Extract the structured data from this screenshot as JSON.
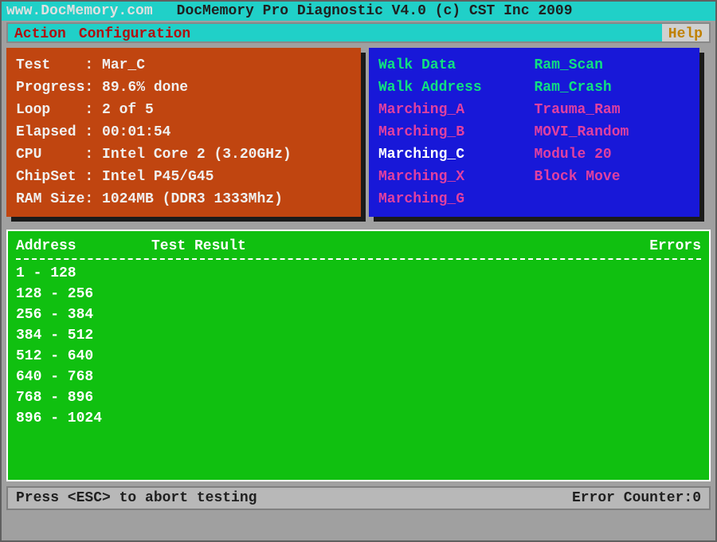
{
  "header": {
    "url": "www.DocMemory.com",
    "product": "DocMemory Pro Diagnostic V4.0  (c) CST Inc 2009"
  },
  "menu": {
    "action": "Action",
    "configuration": "Configuration",
    "help": "Help"
  },
  "status": {
    "test_label": "Test    : ",
    "test_value": "Mar_C",
    "progress_label": "Progress: ",
    "progress_value": "89.6% done",
    "loop_label": "Loop    : ",
    "loop_value": "2 of 5",
    "elapsed_label": "Elapsed : ",
    "elapsed_value": "00:01:54",
    "cpu_label": "CPU     : ",
    "cpu_value": "Intel Core 2 (3.20GHz)",
    "chipset_label": "ChipSet : ",
    "chipset_value": "Intel P45/G45",
    "ram_label": "RAM Size: ",
    "ram_value": "1024MB (DDR3 1333Mhz)"
  },
  "tests": {
    "col1": [
      {
        "name": "Walk Data",
        "color": "c-green"
      },
      {
        "name": "Walk Address",
        "color": "c-green"
      },
      {
        "name": "Marching_A",
        "color": "c-pink"
      },
      {
        "name": "Marching_B",
        "color": "c-pink"
      },
      {
        "name": "Marching_C",
        "color": "c-white"
      },
      {
        "name": "Marching_X",
        "color": "c-pink"
      },
      {
        "name": "Marching_G",
        "color": "c-pink"
      }
    ],
    "col2": [
      {
        "name": "Ram_Scan",
        "color": "c-green"
      },
      {
        "name": "Ram_Crash",
        "color": "c-green"
      },
      {
        "name": "Trauma_Ram",
        "color": "c-pink"
      },
      {
        "name": "MOVI_Random",
        "color": "c-pink"
      },
      {
        "name": "Module 20",
        "color": "c-pink"
      },
      {
        "name": "Block Move",
        "color": "c-pink"
      }
    ]
  },
  "results": {
    "header_address": "Address",
    "header_result": "Test Result",
    "header_errors": "Errors",
    "rows": [
      "1 - 128",
      "128 - 256",
      "256 - 384",
      "384 - 512",
      "512 - 640",
      "640 - 768",
      "768 - 896",
      "896 - 1024"
    ]
  },
  "footer": {
    "hint": "Press <ESC> to abort testing",
    "counter_label": "Error Counter: ",
    "counter_value": "0"
  }
}
